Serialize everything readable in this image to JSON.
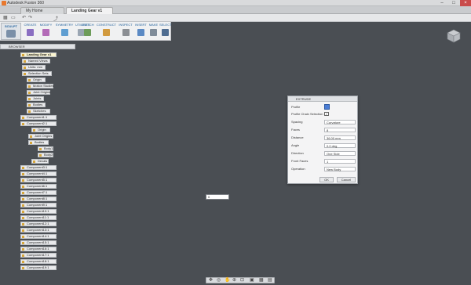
{
  "app": {
    "title": "Autodesk Fusion 360"
  },
  "tabs": [
    {
      "label": "My Home"
    },
    {
      "label": "Landing Gear v1"
    }
  ],
  "toolbar": {
    "workspace": "SCULPT",
    "groups": [
      "CREATE",
      "MODIFY",
      "SYMMETRY",
      "UTILITIES",
      "SKETCH",
      "CONSTRUCT",
      "INSPECT",
      "INSERT",
      "MAKE",
      "SELECT"
    ]
  },
  "browser": {
    "header": "BROWSER",
    "root": "Landing Gear v1",
    "items": [
      "Named Views",
      "Units: mm",
      "Selection Sets",
      "Origin",
      "Motion Studies",
      "Joint Origins",
      "Joints",
      "Bodies",
      "Sketches",
      "Component1:1",
      "Component2:1",
      "Origin",
      "Joint Origins",
      "Bodies",
      "Body1",
      "Body2",
      "Decals",
      "Component3:1",
      "Component4:1",
      "Component5:1",
      "Component6:1",
      "Component7:1",
      "Component8:1",
      "Component9:1",
      "Component10:1",
      "Component11:1",
      "Component12:1",
      "Component13:1",
      "Component14:1",
      "Component15:1",
      "Component16:1",
      "Component17:1",
      "Component18:1",
      "Component19:1"
    ]
  },
  "dialog": {
    "title": "EXTRUDE",
    "rows": [
      {
        "label": "Profile",
        "value": ""
      },
      {
        "label": "Profile Chain Selection",
        "value": ""
      },
      {
        "label": "Spacing",
        "value": "Curvature"
      },
      {
        "label": "Faces",
        "value": "8"
      },
      {
        "label": "Distance",
        "value": "36.00 mm"
      },
      {
        "label": "Angle",
        "value": "0.0 deg"
      },
      {
        "label": "Direction",
        "value": "One Side"
      },
      {
        "label": "Front Faces",
        "value": "1"
      },
      {
        "label": "Operation",
        "value": "New Body"
      }
    ],
    "ok": "OK",
    "cancel": "Cancel"
  },
  "viewport": {
    "distance_value": "0"
  },
  "colors": {
    "accent": "#3a78d6",
    "selection_blue": "#2f6fd9",
    "background": "#4a4e53"
  }
}
